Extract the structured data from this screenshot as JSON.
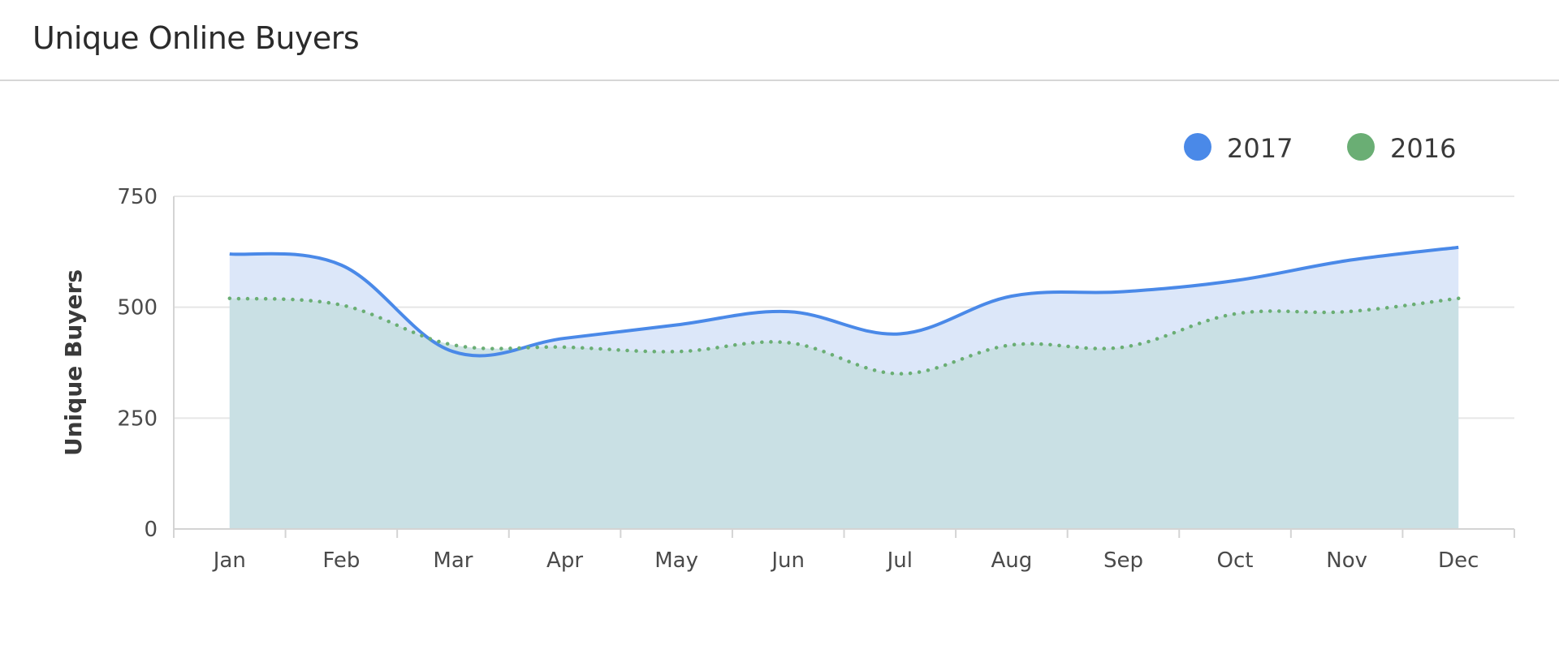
{
  "header": {
    "title": "Unique Online Buyers"
  },
  "colors": {
    "series_2017_line": "#4a89e8",
    "series_2017_fill": "#dce7f9",
    "series_2016_line": "#6aae74",
    "series_2016_fill": "#c5dee1",
    "grid": "#e6e6e6",
    "axis": "#d4d4d4"
  },
  "chart_data": {
    "type": "area",
    "title": "Unique Online Buyers",
    "xlabel": "",
    "ylabel": "Unique Buyers",
    "categories": [
      "Jan",
      "Feb",
      "Mar",
      "Apr",
      "May",
      "Jun",
      "Jul",
      "Aug",
      "Sep",
      "Oct",
      "Nov",
      "Dec"
    ],
    "yticks": [
      0,
      250,
      500,
      750
    ],
    "ylim": [
      0,
      750
    ],
    "grid": true,
    "legend_position": "top-right",
    "series": [
      {
        "name": "2017",
        "style": "solid",
        "values": [
          620,
          595,
          400,
          430,
          460,
          490,
          440,
          525,
          535,
          560,
          605,
          635
        ]
      },
      {
        "name": "2016",
        "style": "dotted",
        "values": [
          520,
          505,
          415,
          410,
          400,
          420,
          350,
          415,
          410,
          485,
          490,
          520
        ]
      }
    ]
  }
}
